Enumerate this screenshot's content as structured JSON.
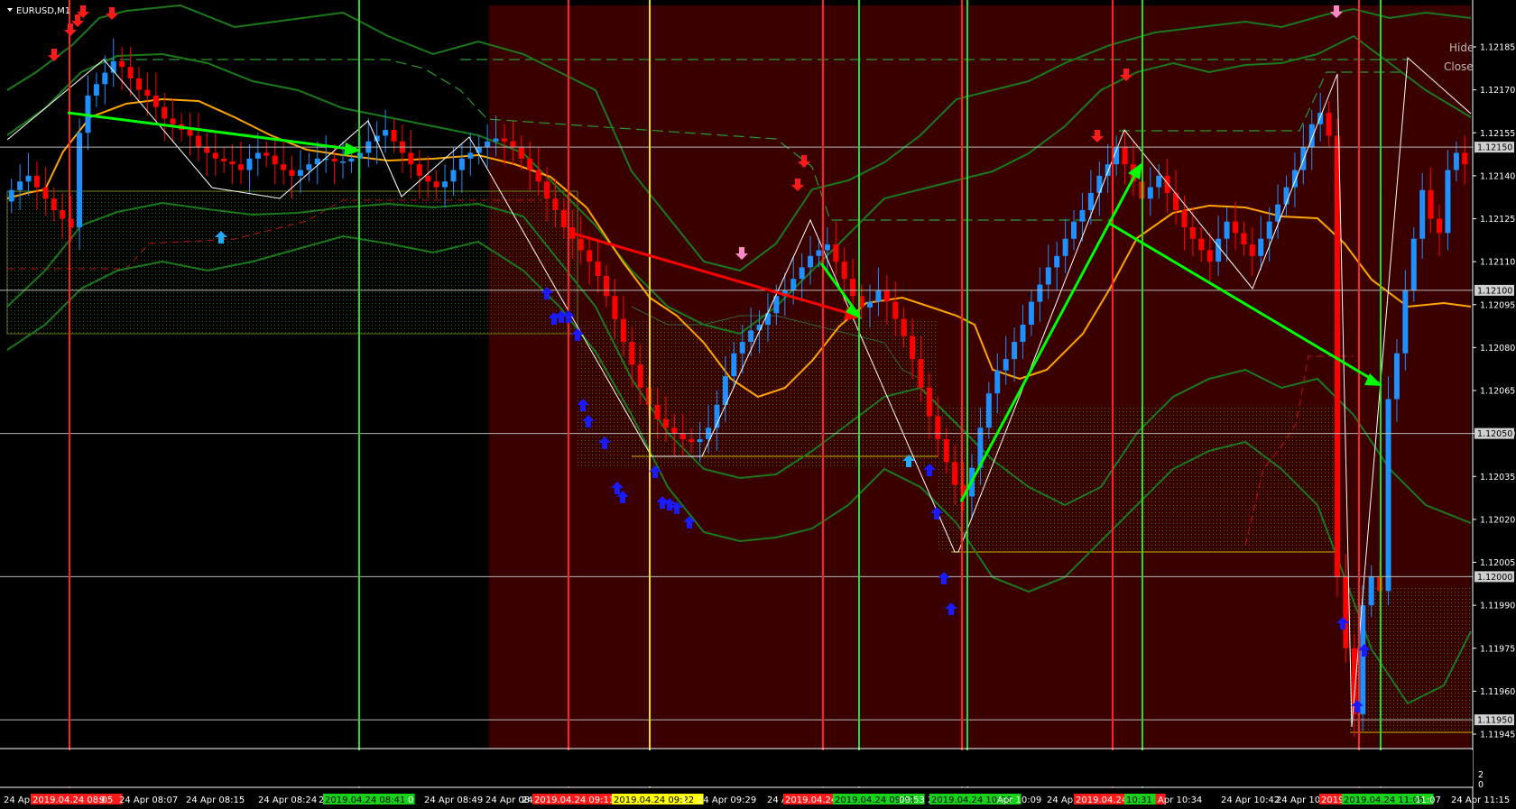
{
  "window": {
    "symbol_label": "EURUSD,M1"
  },
  "buttons": {
    "hide": "Hide",
    "close": "Close"
  },
  "colors": {
    "background": "#000000",
    "shade": "#3a0000",
    "bull_candle": "#1e90ff",
    "bear_candle": "#ff0000",
    "ma_line": "#ffa500",
    "band_line": "#1a7a1a",
    "zigzag": "#ffffff",
    "arrow_trend": "#00ff00",
    "arrow_counter": "#ff0000"
  },
  "chart_data": {
    "type": "candlestick",
    "symbol": "EURUSD",
    "timeframe": "M1",
    "y_ticks": [
      "1.12185",
      "1.12170",
      "1.12155",
      "1.12140",
      "1.12125",
      "1.12110",
      "1.12095",
      "1.12080",
      "1.12065",
      "1.12050",
      "1.12035",
      "1.12020",
      "1.12005",
      "1.11990",
      "1.11975",
      "1.11960",
      "1.11945"
    ],
    "price_levels": [
      {
        "label": "1.12150",
        "value": 1.1215
      },
      {
        "label": "1.12100",
        "value": 1.121
      },
      {
        "label": "1.12050",
        "value": 1.1205
      },
      {
        "label": "1.12000",
        "value": 1.12
      },
      {
        "label": "1.11950",
        "value": 1.1195
      }
    ],
    "x_labels": [
      {
        "text": "24 Apr 2",
        "hl": "none"
      },
      {
        "text": "2019.04.24 08:05",
        "hl": "red"
      },
      {
        "text": "9",
        "hl": "none"
      },
      {
        "text": "24 Apr 08:07",
        "hl": "none"
      },
      {
        "text": "24 Apr 08:15",
        "hl": "none"
      },
      {
        "text": "24 Apr 08:24",
        "hl": "none"
      },
      {
        "text": "24 Apr",
        "hl": "none"
      },
      {
        "text": "2019.04.24 08:41",
        "hl": "green"
      },
      {
        "text": "0",
        "hl": "none"
      },
      {
        "text": "24 Apr 08:49",
        "hl": "none"
      },
      {
        "text": "24 Apr 08:57",
        "hl": "none"
      },
      {
        "text": "24",
        "hl": "none"
      },
      {
        "text": "2019.04.24 09:11",
        "hl": "red"
      },
      {
        "text": "r",
        "hl": "none"
      },
      {
        "text": "2019.04.24 09:22",
        "hl": "yellow"
      },
      {
        "text": "1",
        "hl": "none"
      },
      {
        "text": "24 Apr 09:29",
        "hl": "none"
      },
      {
        "text": "24 Apr",
        "hl": "none"
      },
      {
        "text": "2019.04.24 09:46",
        "hl": "red"
      },
      {
        "text": "2019.04.24 09:51",
        "hl": "green"
      },
      {
        "text": "09:53",
        "hl": "none"
      },
      {
        "text": "2",
        "hl": "none"
      },
      {
        "text": "2019.04.24 10:06",
        "hl": "green"
      },
      {
        "text": "Apr 10:09",
        "hl": "none"
      },
      {
        "text": "24 Apr 10:17",
        "hl": "none"
      },
      {
        "text": "2019.04.24 10:26",
        "hl": "red"
      },
      {
        "text": "10:31",
        "hl": "green"
      },
      {
        "text": "Apr 10:34",
        "hl": "none"
      },
      {
        "text": "24 Apr 10:42",
        "hl": "none"
      },
      {
        "text": "24 Apr 10:5",
        "hl": "none"
      },
      {
        "text": "2019",
        "hl": "red"
      },
      {
        "text": "2019.04.24 11:05",
        "hl": "green"
      },
      {
        "text": "11:07",
        "hl": "none"
      },
      {
        "text": "24 Apr 11:15",
        "hl": "none"
      }
    ],
    "vertical_markers": [
      {
        "time": "2019.04.24 08:05",
        "color": "red"
      },
      {
        "time": "2019.04.24 08:41",
        "color": "green"
      },
      {
        "time": "2019.04.24 09:11",
        "color": "red"
      },
      {
        "time": "2019.04.24 09:22",
        "color": "yellow"
      },
      {
        "time": "2019.04.24 09:46",
        "color": "red"
      },
      {
        "time": "2019.04.24 09:51",
        "color": "green"
      },
      {
        "time": "2019.04.24 10:06",
        "color": "red"
      },
      {
        "time": "2019.04.24 10:06",
        "color": "green"
      },
      {
        "time": "2019.04.24 10:26",
        "color": "red"
      },
      {
        "time": "10:31",
        "color": "green"
      },
      {
        "time": "2019",
        "color": "red"
      },
      {
        "time": "2019.04.24 11:05",
        "color": "green"
      }
    ],
    "close_series": [
      1.12135,
      1.12138,
      1.1214,
      1.12136,
      1.12132,
      1.12128,
      1.12125,
      1.12122,
      1.12155,
      1.12168,
      1.12172,
      1.12176,
      1.1218,
      1.12178,
      1.12174,
      1.1217,
      1.12168,
      1.12164,
      1.1216,
      1.12158,
      1.12156,
      1.12154,
      1.1215,
      1.12148,
      1.12146,
      1.12145,
      1.12144,
      1.12142,
      1.12146,
      1.12148,
      1.12147,
      1.12144,
      1.12142,
      1.1214,
      1.12142,
      1.12144,
      1.12146,
      1.12146,
      1.12145,
      1.12145,
      1.12146,
      1.12148,
      1.12152,
      1.12154,
      1.12156,
      1.12152,
      1.12148,
      1.12144,
      1.1214,
      1.12138,
      1.12136,
      1.12138,
      1.12142,
      1.12146,
      1.12148,
      1.1215,
      1.12152,
      1.12153,
      1.12152,
      1.1215,
      1.12146,
      1.12142,
      1.12138,
      1.12132,
      1.12128,
      1.12122,
      1.12118,
      1.12114,
      1.1211,
      1.12105,
      1.12098,
      1.1209,
      1.12082,
      1.12074,
      1.12066,
      1.1206,
      1.12055,
      1.12052,
      1.1205,
      1.12048,
      1.12047,
      1.12048,
      1.12052,
      1.1206,
      1.1207,
      1.12078,
      1.12082,
      1.12086,
      1.12088,
      1.12092,
      1.12098,
      1.121,
      1.12104,
      1.12108,
      1.12112,
      1.12114,
      1.12116,
      1.1211,
      1.12104,
      1.12098,
      1.12094,
      1.12096,
      1.121,
      1.12096,
      1.1209,
      1.12084,
      1.12076,
      1.12066,
      1.12056,
      1.12048,
      1.1204,
      1.12032,
      1.12028,
      1.12038,
      1.12052,
      1.12064,
      1.12072,
      1.12076,
      1.12082,
      1.12088,
      1.12096,
      1.12102,
      1.12108,
      1.12112,
      1.12118,
      1.12124,
      1.12128,
      1.12134,
      1.1214,
      1.12144,
      1.1215,
      1.12144,
      1.12138,
      1.12132,
      1.12136,
      1.1214,
      1.12134,
      1.12128,
      1.12122,
      1.12118,
      1.12114,
      1.1211,
      1.12118,
      1.12124,
      1.1212,
      1.12116,
      1.12112,
      1.12118,
      1.12124,
      1.1213,
      1.12136,
      1.12142,
      1.1215,
      1.12158,
      1.12162,
      1.12154,
      1.12,
      1.11975,
      1.11952,
      1.1199,
      1.12,
      1.11995,
      1.12062,
      1.12078,
      1.121,
      1.12118,
      1.12135,
      1.12125,
      1.1212,
      1.12142,
      1.12148,
      1.12144
    ]
  }
}
